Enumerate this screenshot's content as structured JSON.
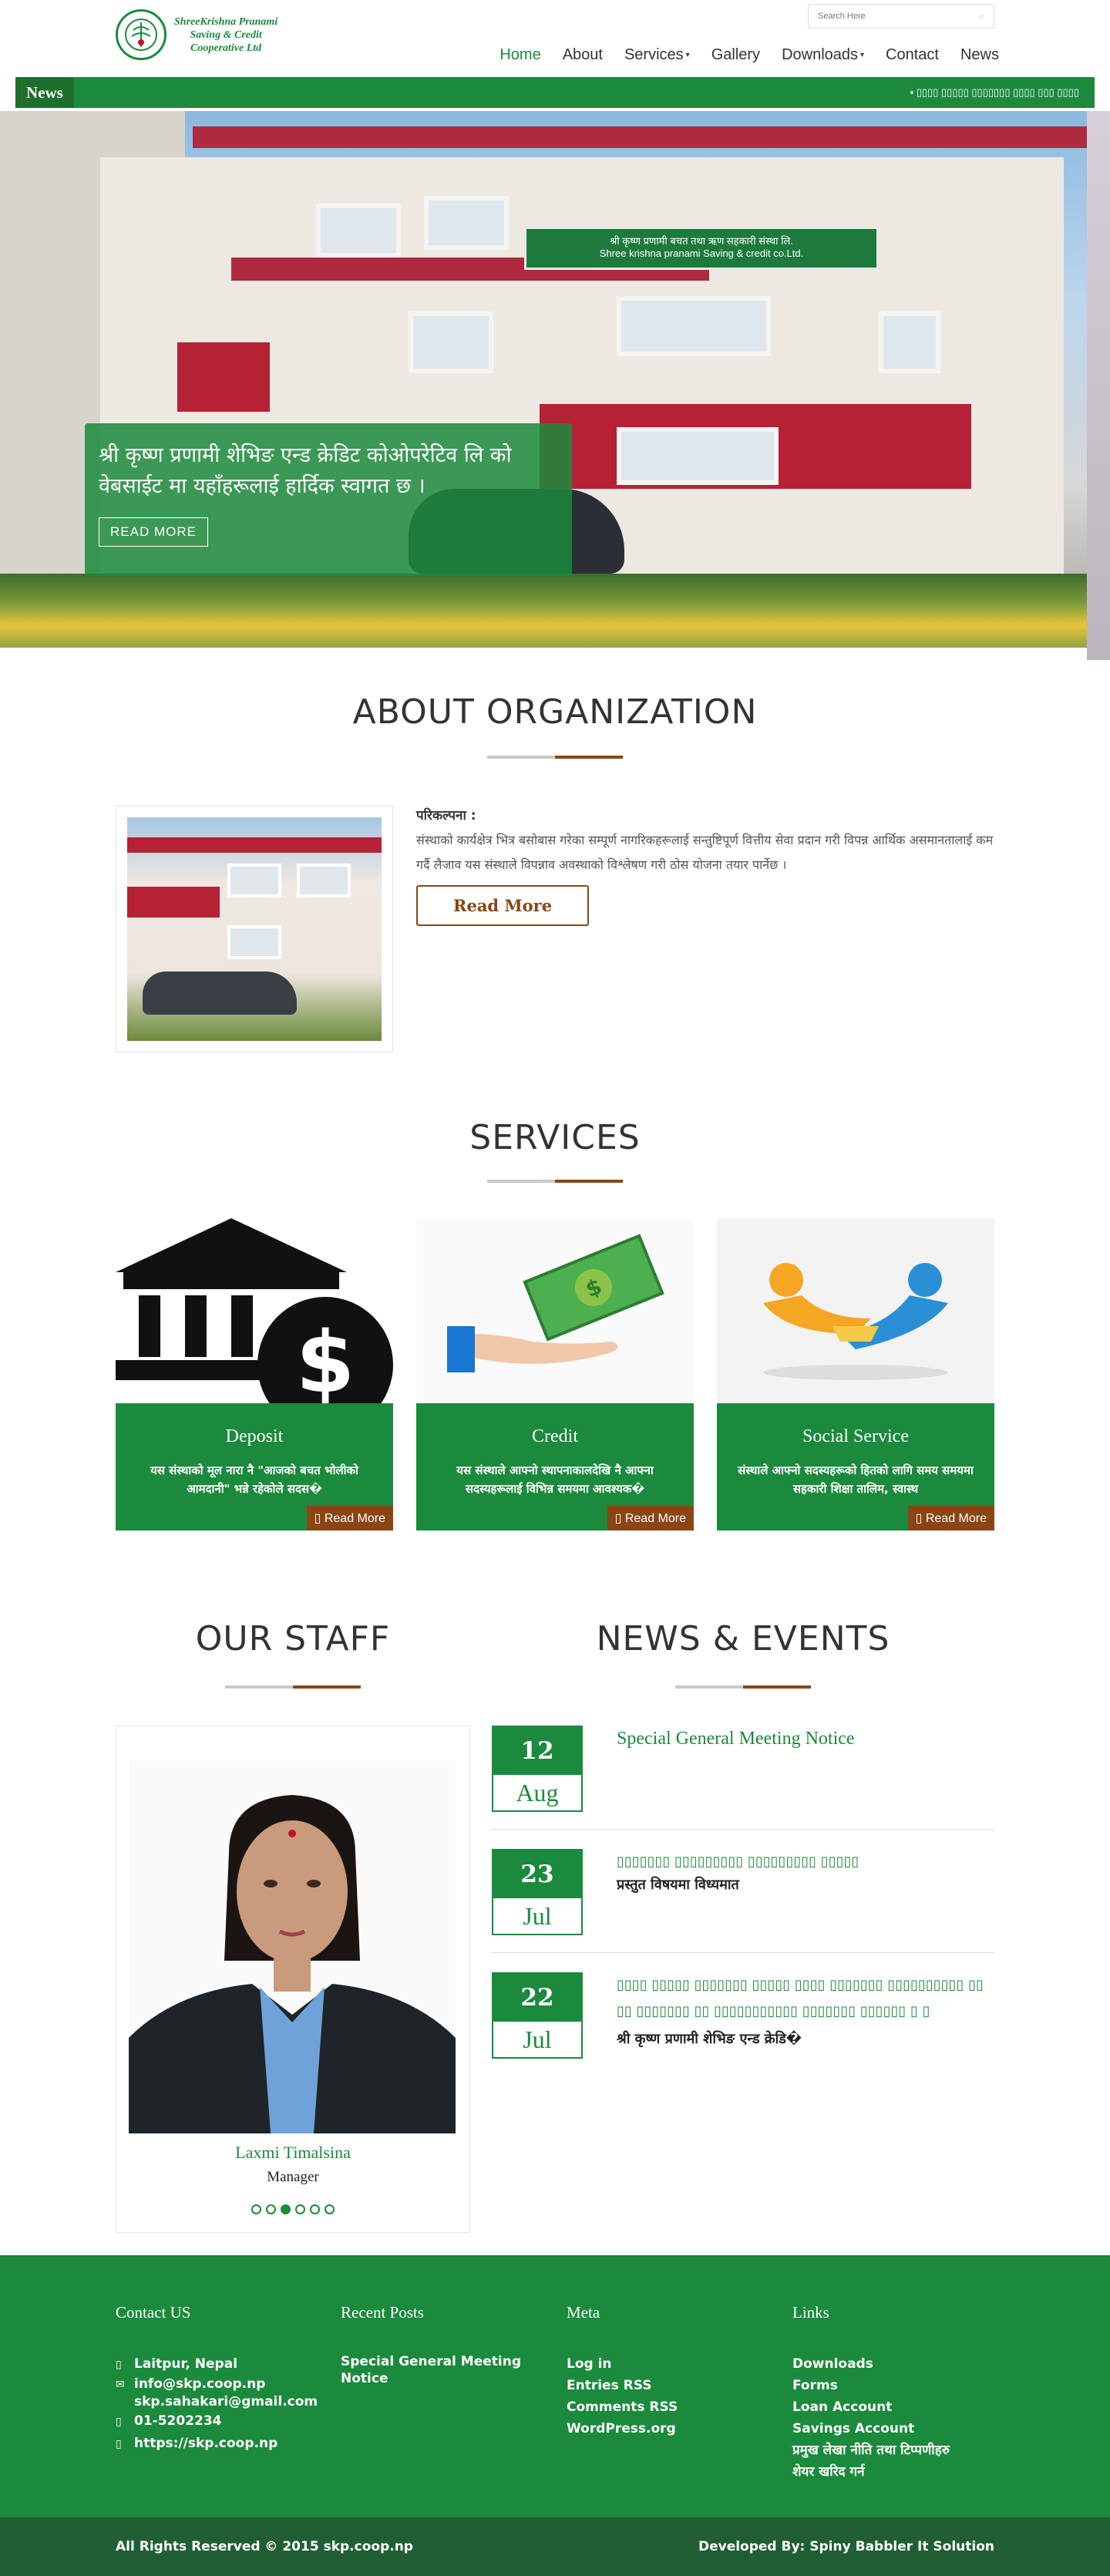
{
  "header": {
    "logo_lines": [
      "ShreeKrishna Pranami",
      "Saving & Credit",
      "Cooperative Ltd"
    ],
    "search_placeholder": "Search Here"
  },
  "nav": [
    {
      "label": "Home",
      "active": true
    },
    {
      "label": "About"
    },
    {
      "label": "Services",
      "dropdown": true
    },
    {
      "label": "Gallery"
    },
    {
      "label": "Downloads",
      "dropdown": true
    },
    {
      "label": "Contact"
    },
    {
      "label": "News"
    }
  ],
  "ticker": {
    "label": "News",
    "text": "▪ ▯▯▯▯ ▯▯▯▯▯ ▯▯▯▯▯▯▯ ▯▯▯▯ ▯▯▯ ▯▯▯▯"
  },
  "hero": {
    "sign_line1": "श्री कृष्ण प्रणामी बचत तथा ऋण सहकारी संस्था लि.",
    "sign_line2": "Shree krishna pranami Saving & credit co.Ltd.",
    "caption": "श्री कृष्ण प्रणामी शेभिङ एन्ड क्रेडिट कोओपरेटिव लि को वेबसाईट मा यहाँहरूलाई हार्दिक स्वागत छ ।",
    "button": "READ MORE"
  },
  "about": {
    "title": "ABOUT ORGANIZATION",
    "heading": "परिकल्पना :",
    "text": "संस्थाको कार्यक्षेत्र भित्र बसोबास गरेका सम्पूर्ण नागरिकहरूलाई सन्तुष्टिपूर्ण वित्तीय सेवा प्रदान गरी विपन्न आर्थिक असमानतालाई कम गर्दै लैजाव यस संस्थाले विपन्नाव अवस्थाको विश्लेषण गरी ठोस योजना तयार पार्नेछ ।",
    "button": "Read More"
  },
  "services": {
    "title": "SERVICES",
    "items": [
      {
        "name": "Deposit",
        "text": "यस संस्थाको मूल नारा नै \"आजको बचत भोलीको आमदानी\" भन्ने रहेकोले सदस�",
        "more": "Read More"
      },
      {
        "name": "Credit",
        "text": "यस संस्थाले आफ्नो स्थापनाकालदेखि नै आफ्ना सदस्यहरूलाई विभिन्न समयमा आवश्यक�",
        "more": "Read More"
      },
      {
        "name": "Social Service",
        "text": "संस्थाले आफ्नो सदस्यहरूको हितको लागि समय समयमा सहकारी शिक्षा तालिम, स्वास्थ",
        "more": "Read More"
      }
    ]
  },
  "staff": {
    "title": "OUR STAFF",
    "name": "Laxmi Timalsina",
    "role": "Manager",
    "dots": 6,
    "active_dot": 3
  },
  "news": {
    "title": "NEWS & EVENTS",
    "items": [
      {
        "day": "12",
        "month": "Aug",
        "title": "Special General Meeting Notice",
        "sub": ""
      },
      {
        "day": "23",
        "month": "Jul",
        "title": "▯▯▯▯▯▯▯ ▯▯▯▯▯▯▯▯▯ ▯▯▯▯▯▯▯▯▯ ▯▯▯▯▯",
        "sub": "प्रस्तुत विषयमा विध्यमात"
      },
      {
        "day": "22",
        "month": "Jul",
        "title": "▯▯▯▯ ▯▯▯▯▯ ▯▯▯▯▯▯▯ ▯▯▯▯▯ ▯▯▯▯ ▯▯▯▯▯▯▯ ▯▯▯▯▯▯▯▯▯▯ ▯▯ ▯▯ ▯▯▯▯▯▯▯ ▯▯ ▯▯▯▯▯▯▯▯▯▯▯ ▯▯▯▯▯▯▯ ▯▯▯▯▯▯ ▯ ▯",
        "sub": "श्री कृष्ण प्रणामी शेभिङ एन्ड क्रेडि�"
      }
    ]
  },
  "footer": {
    "contact": {
      "title": "Contact US",
      "items": [
        {
          "icon": "map-marker-icon",
          "glyph": "▯",
          "text": "Laitpur, Nepal"
        },
        {
          "icon": "envelope-icon",
          "glyph": "✉",
          "text": "info@skp.coop.np"
        },
        {
          "icon": "",
          "glyph": "",
          "text": "skp.sahakari@gmail.com"
        },
        {
          "icon": "phone-icon",
          "glyph": "▯",
          "text": "01-5202234"
        },
        {
          "icon": "globe-icon",
          "glyph": "▯",
          "text": "https://skp.coop.np"
        }
      ]
    },
    "recent": {
      "title": "Recent Posts",
      "items": [
        "Special General Meeting Notice"
      ]
    },
    "meta": {
      "title": "Meta",
      "items": [
        "Log in",
        "Entries RSS",
        "Comments RSS",
        "WordPress.org"
      ]
    },
    "links": {
      "title": "Links",
      "items": [
        "Downloads",
        "Forms",
        "Loan Account",
        "Savings Account",
        "प्रमुख लेखा नीति तथा टिप्पणीहरु",
        "शेयर खरिद गर्न"
      ]
    },
    "copyright": "All Rights Reserved © 2015 skp.coop.np",
    "developer": "Developed By: Spiny Babbler It Solution"
  },
  "colors": {
    "brand_green": "#1b8a3c",
    "accent_brown": "#8b4513",
    "dark_green": "#1f5f33"
  }
}
